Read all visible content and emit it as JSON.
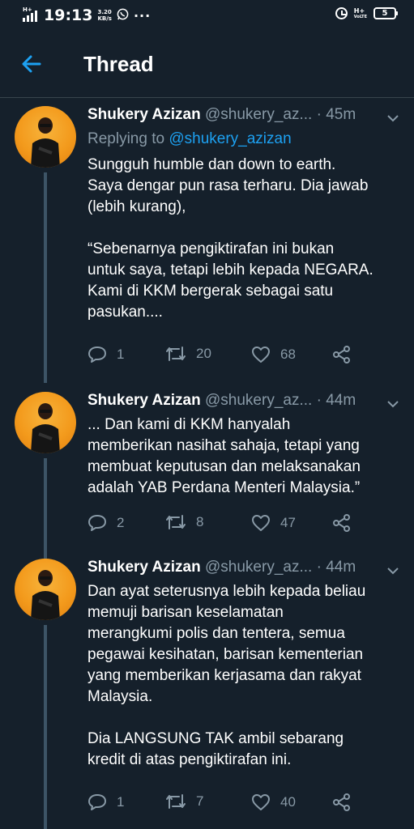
{
  "statusbar": {
    "network_type": "H+",
    "time": "19:13",
    "netspeed_value": "3.20",
    "netspeed_unit": "KB/s",
    "dots": "···",
    "network_type_2": "H+",
    "volte": "VoLTE",
    "battery": "5"
  },
  "header": {
    "title": "Thread"
  },
  "tweets": [
    {
      "name": "Shukery Azizan",
      "handle": "@shukery_az...",
      "dot": "·",
      "time": "45m",
      "reply_prefix": "Replying to",
      "reply_mention": "@shukery_azizan",
      "lines": [
        "Sungguh humble dan down to earth.",
        "Saya dengar pun rasa terharu. Dia jawab",
        "(lebih kurang),",
        "",
        "“Sebenarnya pengiktirafan ini bukan",
        "untuk saya, tetapi lebih kepada NEGARA.",
        "Kami di KKM bergerak sebagai satu",
        "pasukan...."
      ],
      "replies": "1",
      "retweets": "20",
      "likes": "68"
    },
    {
      "name": "Shukery Azizan",
      "handle": "@shukery_az...",
      "dot": "·",
      "time": "44m",
      "lines": [
        "... Dan kami di KKM hanyalah",
        "memberikan nasihat sahaja, tetapi yang",
        "membuat keputusan dan melaksanakan",
        "adalah YAB Perdana Menteri Malaysia.”"
      ],
      "replies": "2",
      "retweets": "8",
      "likes": "47"
    },
    {
      "name": "Shukery Azizan",
      "handle": "@shukery_az...",
      "dot": "·",
      "time": "44m",
      "lines": [
        "Dan ayat seterusnya lebih kepada beliau",
        "memuji barisan keselamatan",
        "merangkumi polis dan tentera, semua",
        "pegawai kesihatan, barisan kementerian",
        "yang memberikan kerjasama dan rakyat",
        "Malaysia.",
        "",
        "Dia LANGSUNG TAK ambil sebarang",
        "kredit di atas pengiktirafan ini."
      ],
      "replies": "1",
      "retweets": "7",
      "likes": "40"
    }
  ],
  "icons": {
    "back": "back-arrow-icon",
    "chevron": "chevron-down-icon",
    "reply": "reply-icon",
    "retweet": "retweet-icon",
    "like": "heart-icon",
    "share": "share-icon"
  },
  "colors": {
    "background": "#15202b",
    "accent": "#1da1f2",
    "secondary_text": "#8899a6",
    "avatar_bg": "#f39a1c"
  }
}
